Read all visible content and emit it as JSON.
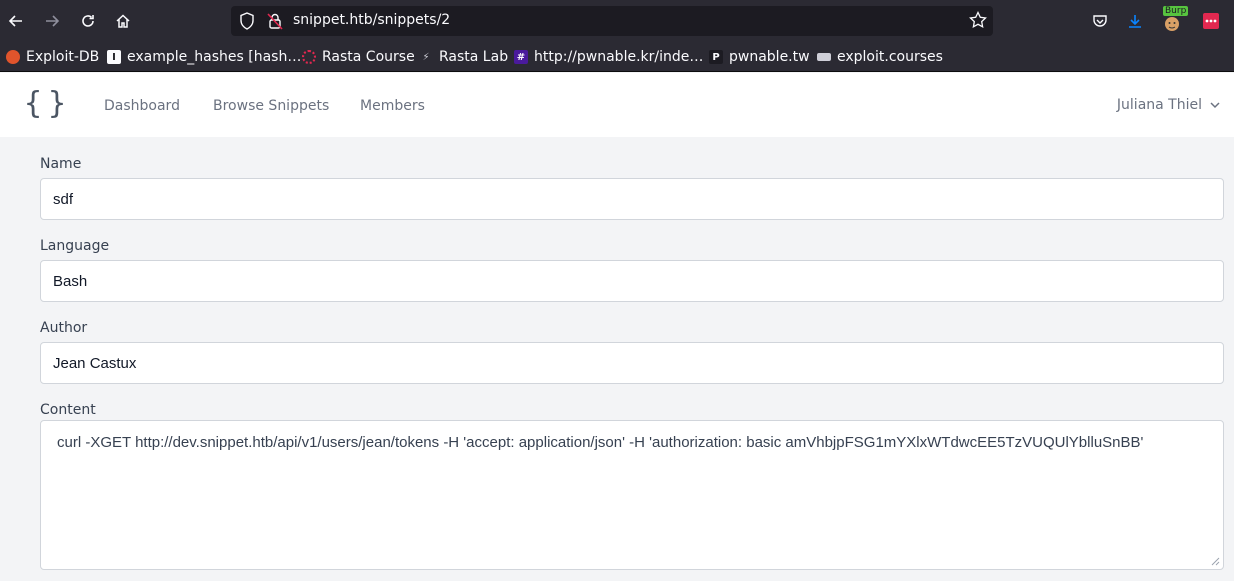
{
  "browser": {
    "url": "snippet.htb/snippets/2",
    "burp_badge": "Burp"
  },
  "bookmarks": [
    {
      "label": "Exploit-DB",
      "icon": "exploitdb-icon"
    },
    {
      "label": "example_hashes [hash…",
      "icon": "hashcat-icon"
    },
    {
      "label": "Rasta Course",
      "icon": "rasta-course-icon"
    },
    {
      "label": "Rasta Lab",
      "icon": "rasta-lab-icon"
    },
    {
      "label": "http://pwnable.kr/inde…",
      "icon": "hash-icon"
    },
    {
      "label": "pwnable.tw",
      "icon": "p-icon"
    },
    {
      "label": "exploit.courses",
      "icon": "exploit-courses-icon"
    }
  ],
  "nav": {
    "logo": "{}",
    "links": [
      "Dashboard",
      "Browse Snippets",
      "Members"
    ],
    "user": "Juliana Thiel"
  },
  "form": {
    "name_label": "Name",
    "name_value": "sdf",
    "language_label": "Language",
    "language_value": "Bash",
    "author_label": "Author",
    "author_value": "Jean Castux",
    "content_label": "Content",
    "content_value": "curl -XGET http://dev.snippet.htb/api/v1/users/jean/tokens -H 'accept: application/json' -H 'authorization: basic amVhbjpFSG1mYXlxWTdwcEE5TzVUQUlYblluSnBB'"
  },
  "colors": {
    "toolbar": "#2b2a33",
    "urlbar": "#1c1b22",
    "page_bg": "#f3f4f6",
    "accent_blue": "#0a84ff",
    "burp_orange": "#e0542c"
  }
}
